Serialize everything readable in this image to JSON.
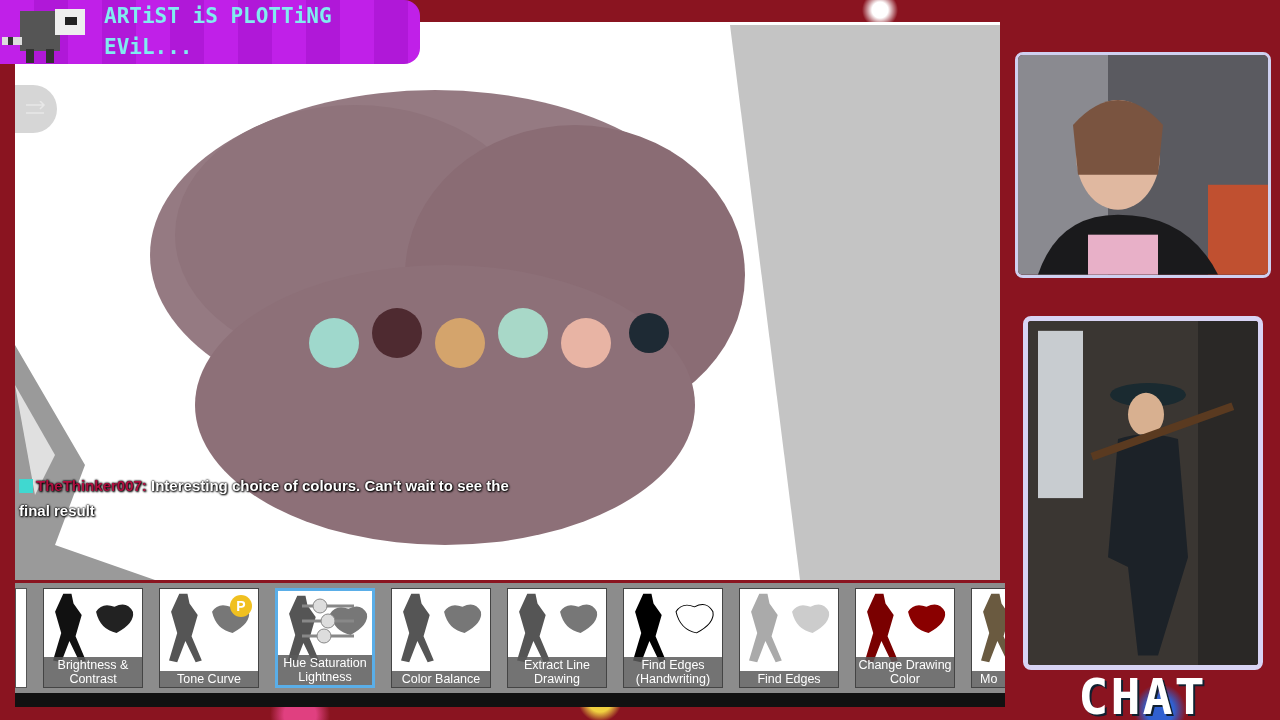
{
  "banner": {
    "title": "ARTiST iS PLOTTiNG EViL..."
  },
  "canvas": {
    "swatches": [
      {
        "color": "#9fd8cc"
      },
      {
        "color": "#4e2a30"
      },
      {
        "color": "#d4a46c"
      },
      {
        "color": "#a8d8c8"
      },
      {
        "color": "#e8b4a4"
      },
      {
        "color": "#1e2a34"
      }
    ]
  },
  "chat_message": {
    "user": "TheThinker007:",
    "text": "Interesting choice of colours. Can't wait to see the final result"
  },
  "filters": [
    {
      "label": "Brightness & Contrast",
      "kind": "dark",
      "selected": false
    },
    {
      "label": "Tone Curve",
      "kind": "grey",
      "badge": "P",
      "selected": false
    },
    {
      "label": "Hue Saturation Lightness",
      "kind": "grey",
      "selected": true
    },
    {
      "label": "Color Balance",
      "kind": "grey",
      "selected": false
    },
    {
      "label": "Extract Line Drawing",
      "kind": "grey",
      "selected": false
    },
    {
      "label": "Find Edges (Handwriting)",
      "kind": "lines",
      "selected": false
    },
    {
      "label": "Find Edges",
      "kind": "faint",
      "selected": false
    },
    {
      "label": "Change Drawing Color",
      "kind": "red",
      "selected": false
    },
    {
      "label": "Mo",
      "kind": "sepia",
      "selected": false
    }
  ],
  "chat_panel": {
    "title": "CHAT"
  }
}
